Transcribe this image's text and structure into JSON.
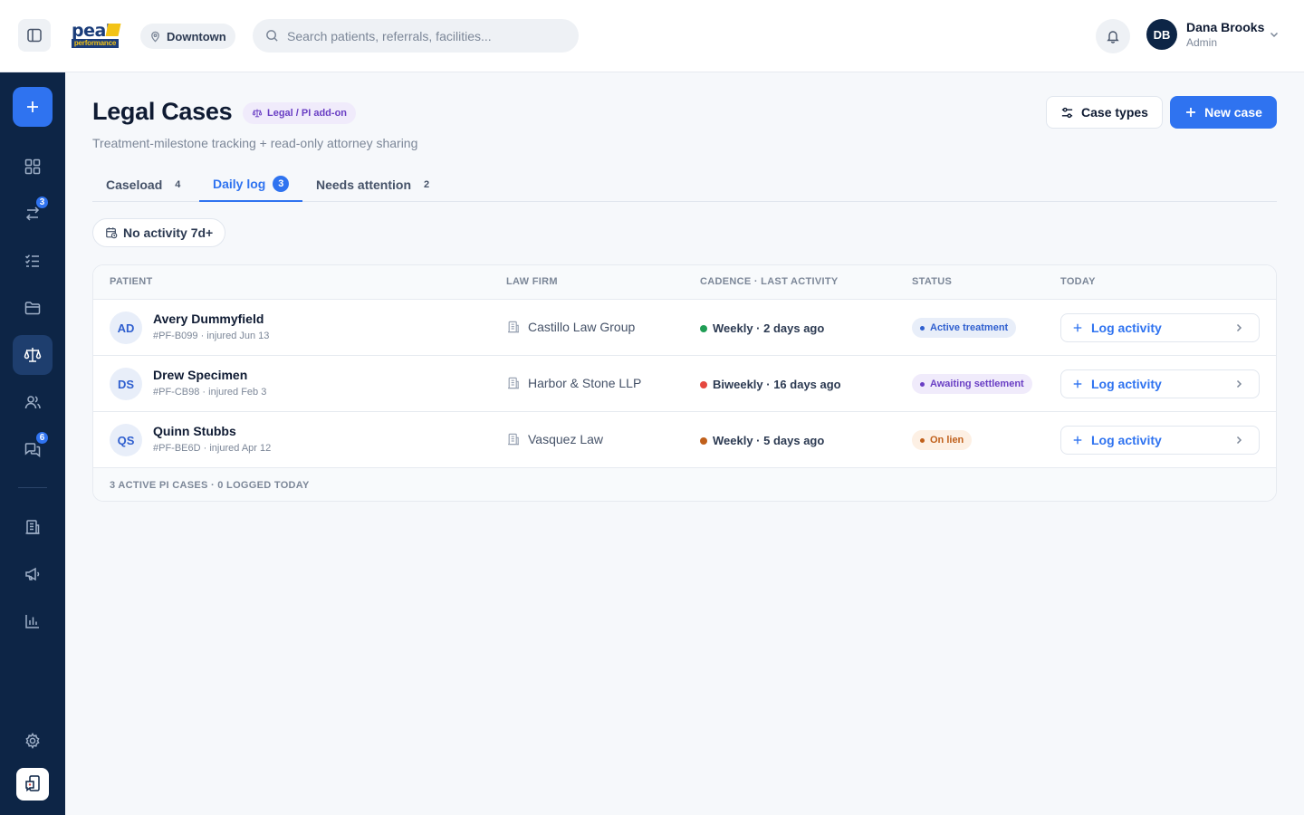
{
  "topbar": {
    "logo_line1": "peak",
    "logo_line2": "performance",
    "location": "Downtown",
    "search_placeholder": "Search patients, referrals, facilities...",
    "user_initials": "DB",
    "user_name": "Dana Brooks",
    "user_role": "Admin"
  },
  "sidebar": {
    "badges": {
      "referrals": "3",
      "messages": "6"
    }
  },
  "page": {
    "title": "Legal Cases",
    "addon_badge": "Legal / PI add-on",
    "subtitle": "Treatment-milestone tracking + read-only attorney sharing",
    "case_types_label": "Case types",
    "new_case_label": "New case"
  },
  "tabs": [
    {
      "label": "Caseload",
      "count": "4"
    },
    {
      "label": "Daily log",
      "count": "3"
    },
    {
      "label": "Needs attention",
      "count": "2"
    }
  ],
  "filter_chip": "No activity 7d+",
  "table": {
    "headers": [
      "PATIENT",
      "LAW FIRM",
      "CADENCE · LAST ACTIVITY",
      "STATUS",
      "TODAY"
    ],
    "rows": [
      {
        "initials": "AD",
        "name": "Avery Dummyfield",
        "meta": "#PF-B099 · injured Jun 13",
        "firm": "Castillo Law Group",
        "cadence": "Weekly · 2 days ago",
        "cadence_color": "#1f9d55",
        "status": "Active treatment",
        "status_fg": "#2f5fcf",
        "status_bg": "#e8eef9",
        "action": "Log activity"
      },
      {
        "initials": "DS",
        "name": "Drew Specimen",
        "meta": "#PF-CB98 · injured Feb 3",
        "firm": "Harbor & Stone LLP",
        "cadence": "Biweekly · 16 days ago",
        "cadence_color": "#e5483f",
        "status": "Awaiting settlement",
        "status_fg": "#6a3fc4",
        "status_bg": "#f0ebfb",
        "action": "Log activity"
      },
      {
        "initials": "QS",
        "name": "Quinn Stubbs",
        "meta": "#PF-BE6D · injured Apr 12",
        "firm": "Vasquez Law",
        "cadence": "Weekly · 5 days ago",
        "cadence_color": "#c0601b",
        "status": "On lien",
        "status_fg": "#c0601b",
        "status_bg": "#fdf0e4",
        "action": "Log activity"
      }
    ],
    "footer": "3 ACTIVE PI CASES · 0 LOGGED TODAY"
  },
  "colors": {
    "brand": "#2f73f0",
    "sidebar": "#0d2546"
  }
}
